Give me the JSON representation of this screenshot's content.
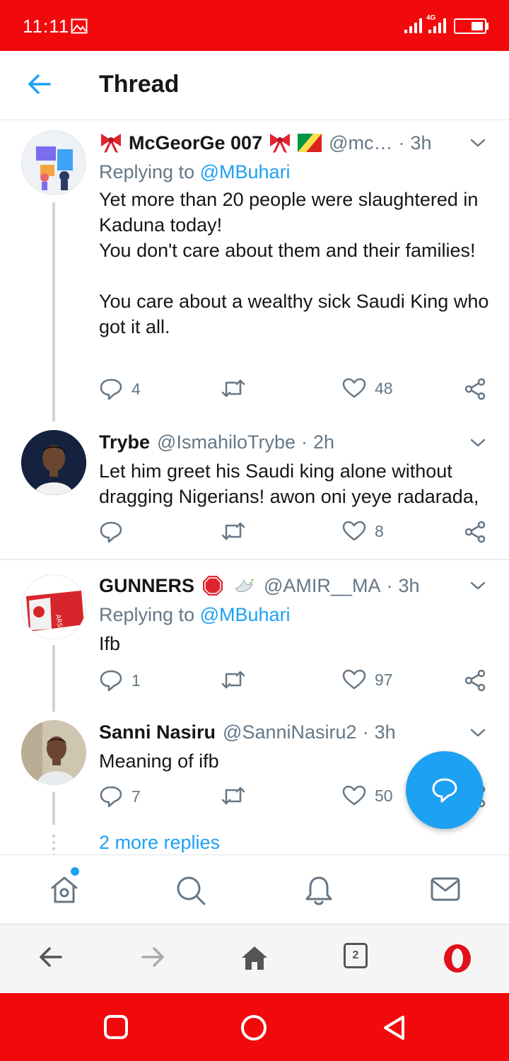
{
  "status_bar": {
    "time": "11:11",
    "network_label": "4G"
  },
  "header": {
    "title": "Thread"
  },
  "tweets": [
    {
      "name": "McGeorGe 007",
      "handle": "@mc…",
      "time": "3h",
      "replying_prefix": "Replying to",
      "replying_to": "@MBuhari",
      "text": "Yet more than 20 people were slaughtered in Kaduna today!\nYou don't care about them and their families!\n\nYou care about a wealthy sick Saudi King who got it all.",
      "replies": "4",
      "retweets": "",
      "likes": "48"
    },
    {
      "name": "Trybe",
      "handle": "@IsmahiloTrybe",
      "time": "2h",
      "text": "Let him greet his Saudi king alone without dragging Nigerians! awon oni yeye radarada,",
      "replies": "",
      "retweets": "",
      "likes": "8"
    },
    {
      "name": "GUNNERS",
      "handle": "@AMIR__MA",
      "time": "3h",
      "replying_prefix": "Replying to",
      "replying_to": "@MBuhari",
      "avatar_text": "ARSENAL FC",
      "text": "Ifb",
      "replies": "1",
      "retweets": "",
      "likes": "97"
    },
    {
      "name": "Sanni Nasiru",
      "handle": "@SanniNasiru2",
      "time": "3h",
      "text": "Meaning of ifb",
      "replies": "7",
      "retweets": "",
      "likes": "50"
    }
  ],
  "more_replies": "2 more replies",
  "twitter_nav": [
    "home-icon",
    "search-icon",
    "bell-icon",
    "mail-icon"
  ],
  "browser_bar": {
    "tabs_count": "2"
  },
  "colors": {
    "accent": "#1da1f2",
    "status_bar": "#f2090c",
    "muted": "#657786"
  }
}
